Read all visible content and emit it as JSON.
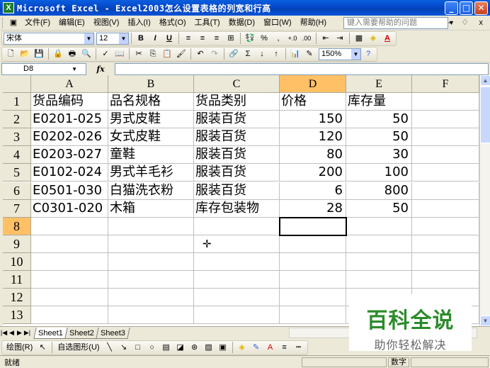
{
  "window": {
    "title": "Microsoft Excel - Excel2003怎么设置表格的列宽和行高",
    "app_icon": "excel-icon",
    "buttons": [
      "_",
      "□",
      "✕"
    ]
  },
  "menu": {
    "items": [
      "文件(F)",
      "编辑(E)",
      "视图(V)",
      "插入(I)",
      "格式(O)",
      "工具(T)",
      "数据(D)",
      "窗口(W)",
      "帮助(H)"
    ],
    "help_placeholder": "键入需要帮助的问题",
    "doc_controls": "- ♢ x"
  },
  "format_toolbar": {
    "font": "宋体",
    "size": "12",
    "buttons": [
      "B",
      "I",
      "U",
      "≡",
      "≡",
      "≡",
      "⊞",
      "%",
      ",",
      "+.0",
      ".00",
      "⇤",
      "⇥",
      "▦",
      "A"
    ]
  },
  "standard_toolbar": {
    "zoom": "150%"
  },
  "formula_bar": {
    "name_box": "D8",
    "fx": "fx",
    "formula": ""
  },
  "sheet": {
    "columns": [
      "A",
      "B",
      "C",
      "D",
      "E",
      "F"
    ],
    "active_column": "D",
    "active_row": "8",
    "row_numbers": [
      "1",
      "2",
      "3",
      "4",
      "5",
      "6",
      "7",
      "8",
      "9",
      "10",
      "11",
      "12",
      "13"
    ],
    "rows": [
      [
        "货品编码",
        "品名规格",
        "货品类别",
        "价格",
        "库存量",
        ""
      ],
      [
        "E0201-025",
        "男式皮鞋",
        "服装百货",
        "150",
        "50",
        ""
      ],
      [
        "E0202-026",
        "女式皮鞋",
        "服装百货",
        "120",
        "50",
        ""
      ],
      [
        "E0203-027",
        "童鞋",
        "服装百货",
        "80",
        "30",
        ""
      ],
      [
        "E0102-024",
        "男式羊毛衫",
        "服装百货",
        "200",
        "100",
        ""
      ],
      [
        "E0501-030",
        "白猫洗衣粉",
        "服装百货",
        "6",
        "800",
        ""
      ],
      [
        "C0301-020",
        "木箱",
        "库存包装物",
        "28",
        "50",
        ""
      ]
    ]
  },
  "tabs": {
    "sheets": [
      "Sheet1",
      "Sheet2",
      "Sheet3"
    ],
    "active": "Sheet1"
  },
  "draw_toolbar": {
    "draw_label": "绘图(R)",
    "autoshapes_label": "自选图形(U)"
  },
  "status": {
    "left": "就绪",
    "mode": "数字"
  },
  "watermark": {
    "title": "百科全说",
    "subtitle": "助你轻松解决"
  }
}
